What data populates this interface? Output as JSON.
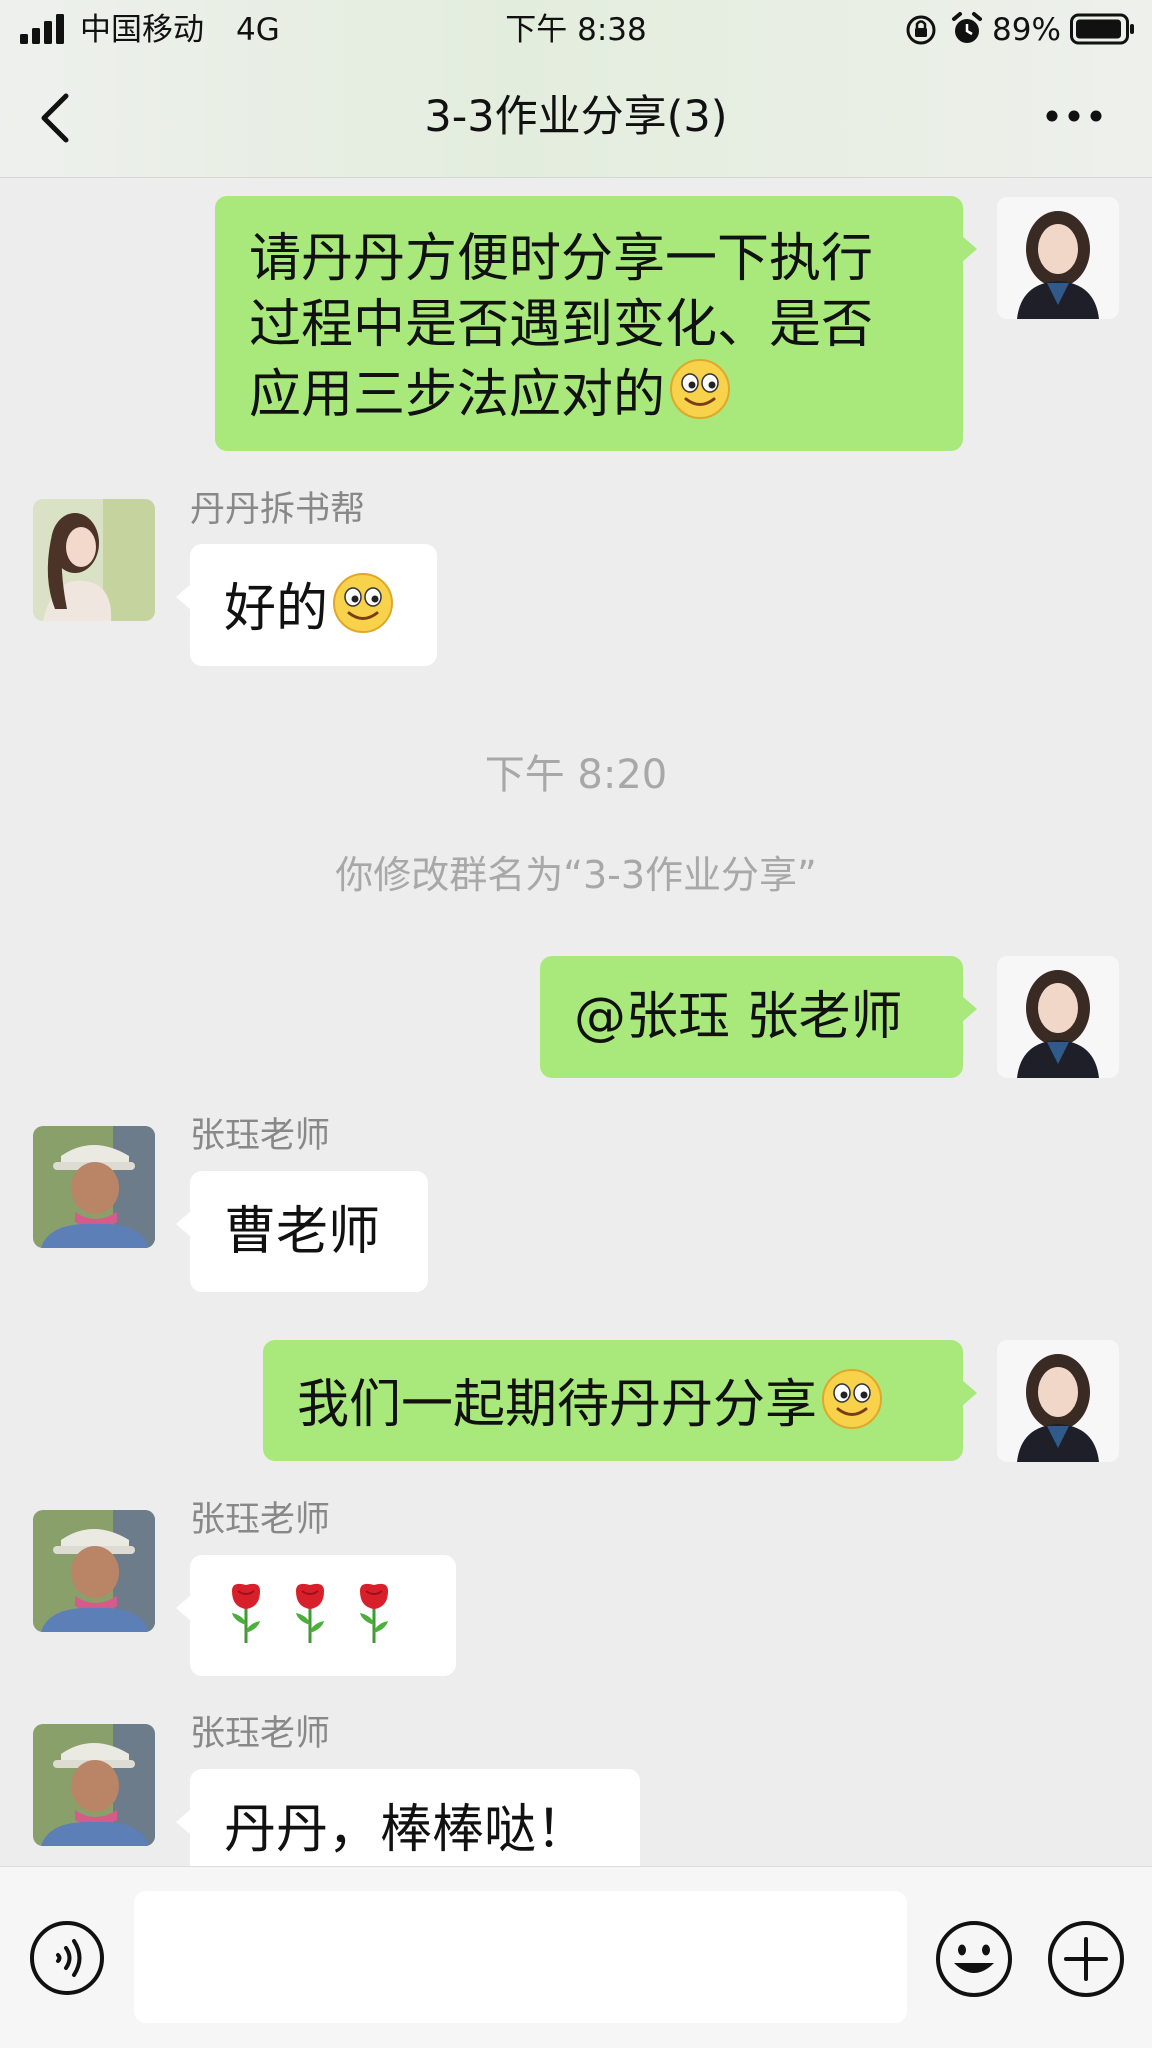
{
  "status_bar": {
    "carrier": "中国移动",
    "network": "4G",
    "time": "下午 8:38",
    "battery_percent": "89%"
  },
  "nav": {
    "title": "3-3作业分享(3)",
    "back_icon": "chevron-left-icon",
    "more_icon": "more-dots-icon"
  },
  "messages": [
    {
      "direction": "out",
      "line1": "请丹丹方便时分享一下执行",
      "line2": "过程中是否遇到变化、是否",
      "line3": "应用三步法应对的",
      "emoji": "smile-emoji"
    },
    {
      "direction": "in",
      "sender": "丹丹拆书帮",
      "text": "好的",
      "emoji": "smile-emoji"
    },
    {
      "type": "time",
      "text": "下午 8:20"
    },
    {
      "type": "system",
      "text": "你修改群名为“3-3作业分享”"
    },
    {
      "direction": "out",
      "text": "@张珏 张老师"
    },
    {
      "direction": "in",
      "sender": "张珏老师",
      "text": "曹老师"
    },
    {
      "direction": "out",
      "text": "我们一起期待丹丹分享",
      "emoji": "smile-emoji"
    },
    {
      "direction": "in",
      "sender": "张珏老师",
      "emoji": "rose-emoji",
      "emoji_count": 3
    },
    {
      "direction": "in",
      "sender": "张珏老师",
      "text": "丹丹，棒棒哒！"
    }
  ],
  "input_bar": {
    "voice_icon": "voice-icon",
    "emoji_icon": "emoji-icon",
    "plus_icon": "plus-icon",
    "placeholder": ""
  },
  "colors": {
    "outgoing_bubble": "#a9e97b",
    "incoming_bubble": "#ffffff",
    "chat_background": "#ededed"
  }
}
